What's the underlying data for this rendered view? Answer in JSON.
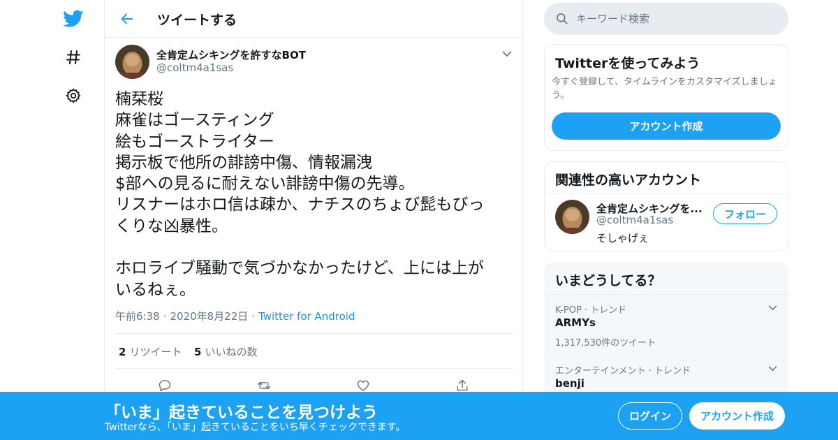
{
  "colors": {
    "brand": "#1da1f2",
    "text_primary": "#14171a",
    "text_secondary": "#657786",
    "border": "#e6ecf0",
    "panel_bg": "#f5f8fa"
  },
  "nav": {
    "icons": [
      "twitter-bird-icon",
      "hashtag-icon",
      "settings-gear-icon"
    ]
  },
  "header": {
    "back_icon": "back-arrow-icon",
    "title": "ツイートする"
  },
  "tweet": {
    "author_name": "全肯定ムシキングを許すなBOT",
    "author_handle": "@coltm4a1sas",
    "lines": [
      "楠栞桜",
      "麻雀はゴースティング",
      "絵もゴーストライター",
      "掲示板で他所の誹謗中傷、情報漏洩",
      "$部への見るに耐えない誹謗中傷の先導。",
      "リスナーはホロ信は疎か、ナチスのちょび髭もびっ",
      "くりな凶暴性。",
      "",
      "ホロライブ騒動で気づかなかったけど、上には上が",
      "いるねぇ。"
    ],
    "time": "午前6:38",
    "date": "2020年8月22日",
    "separator": "·",
    "source": "Twitter for Android",
    "retweet_count": "2",
    "retweet_label": "リツイート",
    "like_count": "5",
    "like_label": "いいねの数",
    "action_icons": [
      "reply-icon",
      "retweet-icon",
      "like-heart-icon",
      "share-icon"
    ]
  },
  "search": {
    "placeholder": "キーワード検索"
  },
  "try_card": {
    "title": "Twitterを使ってみよう",
    "description": "今すぐ登録して、タイムラインをカスタマイズしましょう。",
    "button": "アカウント作成"
  },
  "related": {
    "title": "関連性の高いアカウント",
    "name": "全肯定ムシキングを...",
    "handle": "@coltm4a1sas",
    "bio": "そしゃげぇ",
    "follow": "フォロー"
  },
  "trends": {
    "title": "いまどうしてる？",
    "items": [
      {
        "meta": "K-POP · トレンド",
        "name": "ARMYs",
        "count": "1,317,530件のツイート"
      },
      {
        "meta": "エンターテインメント · トレンド",
        "name": "benji",
        "count": ""
      }
    ]
  },
  "banner": {
    "title": "「いま」起きていることを見つけよう",
    "subtitle": "Twitterなら、「いま」起きていることをいち早くチェックできます。",
    "login": "ログイン",
    "signup": "アカウント作成"
  }
}
